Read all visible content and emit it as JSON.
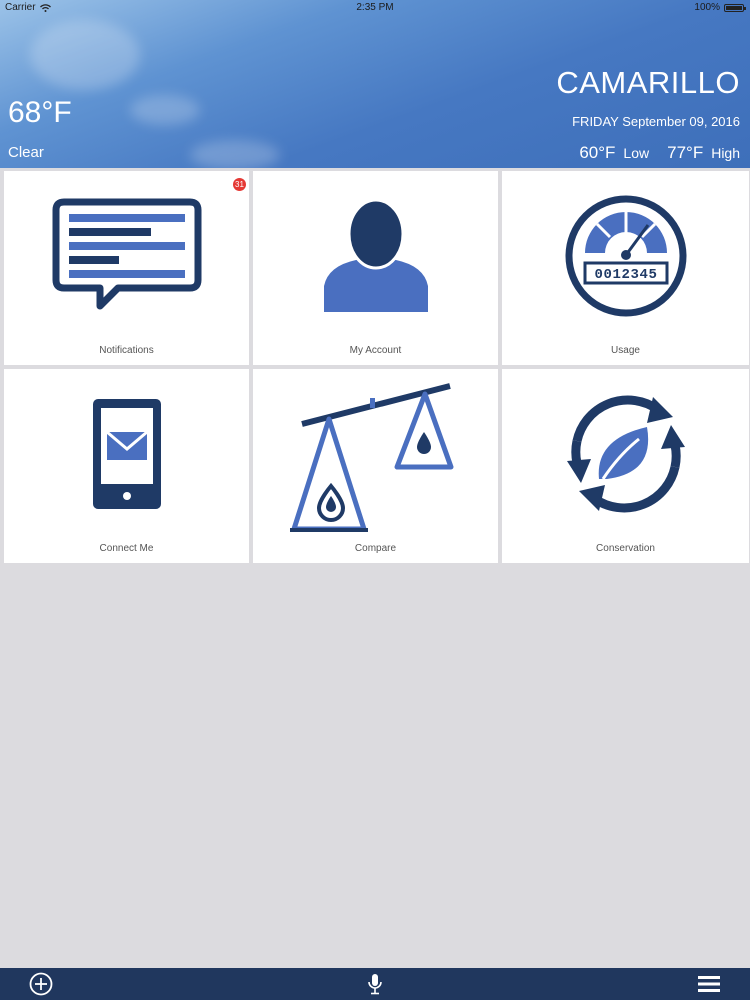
{
  "status": {
    "carrier": "Carrier",
    "time": "2:35 PM",
    "battery": "100%"
  },
  "weather": {
    "temperature": "68°F",
    "condition": "Clear",
    "city": "CAMARILLO",
    "date": "FRIDAY September 09, 2016",
    "low_temp": "60°F",
    "low_label": "Low",
    "high_temp": "77°F",
    "high_label": "High"
  },
  "tiles": [
    {
      "label": "Notifications",
      "icon": "chat-bubble-icon",
      "badge": "31"
    },
    {
      "label": "My Account",
      "icon": "user-silhouette-icon"
    },
    {
      "label": "Usage",
      "icon": "meter-gauge-icon",
      "meter_digits": "0012345"
    },
    {
      "label": "Connect Me",
      "icon": "phone-mail-icon"
    },
    {
      "label": "Compare",
      "icon": "balance-scale-icon"
    },
    {
      "label": "Conservation",
      "icon": "recycle-leaf-icon"
    }
  ],
  "tabbar": {
    "items": [
      {
        "icon": "add-circle-icon"
      },
      {
        "icon": "microphone-icon"
      },
      {
        "icon": "menu-icon"
      }
    ]
  },
  "colors": {
    "tile_blue": "#4a6fc0",
    "tile_navy": "#1f3a66",
    "tabbar": "#20375e",
    "background": "#dcdbdf",
    "badge": "#e53935"
  }
}
